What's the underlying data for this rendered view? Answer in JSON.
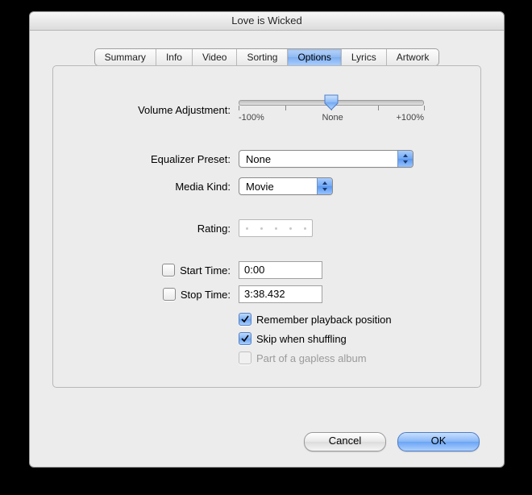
{
  "window": {
    "title": "Love is Wicked"
  },
  "tabs": [
    {
      "label": "Summary"
    },
    {
      "label": "Info"
    },
    {
      "label": "Video"
    },
    {
      "label": "Sorting"
    },
    {
      "label": "Options"
    },
    {
      "label": "Lyrics"
    },
    {
      "label": "Artwork"
    }
  ],
  "activeTab": 4,
  "options": {
    "volume_label": "Volume Adjustment:",
    "volume_ticks": {
      "min": "-100%",
      "mid": "None",
      "max": "+100%"
    },
    "volume_value": 0,
    "eq_label": "Equalizer Preset:",
    "eq_value": "None",
    "media_label": "Media Kind:",
    "media_value": "Movie",
    "rating_label": "Rating:",
    "rating_value": 0,
    "start_label": "Start Time:",
    "start_checked": false,
    "start_value": "0:00",
    "stop_label": "Stop Time:",
    "stop_checked": false,
    "stop_value": "3:38.432",
    "remember_label": "Remember playback position",
    "remember_checked": true,
    "skip_label": "Skip when shuffling",
    "skip_checked": true,
    "gapless_label": "Part of a gapless album",
    "gapless_checked": false,
    "gapless_disabled": true
  },
  "buttons": {
    "cancel": "Cancel",
    "ok": "OK"
  }
}
